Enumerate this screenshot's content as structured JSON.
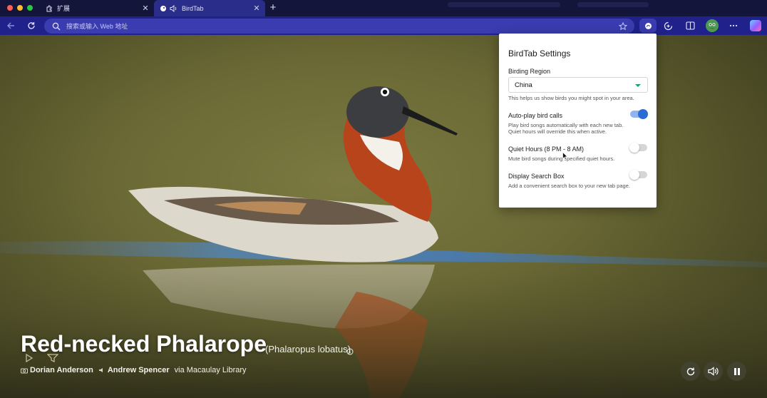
{
  "browser": {
    "tabs": [
      {
        "label": "扩展",
        "icon": "puzzle-icon"
      },
      {
        "label": "BirdTab",
        "icon": "birdtab-icon",
        "audio_icon": "speaker-icon",
        "active": true
      }
    ],
    "close_label": "✕",
    "new_tab_label": "+",
    "omnibox_placeholder": "搜索或输入 Web 地址",
    "toolbar_icons": [
      "back-icon",
      "reload-icon",
      "search-icon",
      "favorite-star-icon",
      "birdtab-extension-icon",
      "extensions-icon",
      "split-screen-icon",
      "profile-avatar",
      "more-icon",
      "copilot-icon"
    ],
    "accent_color": "#20218a"
  },
  "settings": {
    "title": "BirdTab Settings",
    "region_label": "Birding Region",
    "region_value": "China",
    "region_help": "This helps us show birds you might spot in your area.",
    "autoplay_label": "Auto-play bird calls",
    "autoplay_on": true,
    "autoplay_help_line1": "Play bird songs automatically with each new tab.",
    "autoplay_help_line2": "Quiet hours will override this when active.",
    "quiet_label": "Quiet Hours (8 PM - 8 AM)",
    "quiet_on": false,
    "quiet_help": "Mute bird songs during specified quiet hours.",
    "search_label": "Display Search Box",
    "search_on": false,
    "search_help": "Add a convenient search box to your new tab page.",
    "toggle_on_color": "#2b6bd6"
  },
  "bird": {
    "common_name": "Red-necked Phalarope",
    "scientific_name": "(Phalaropus lobatus)",
    "photographer": "Dorian Anderson",
    "recordist": "Andrew Spencer",
    "source": "via Macaulay Library",
    "caption_icons": [
      "play-icon",
      "filter-icon"
    ],
    "controls": [
      "refresh-icon",
      "volume-icon",
      "pause-icon"
    ]
  }
}
